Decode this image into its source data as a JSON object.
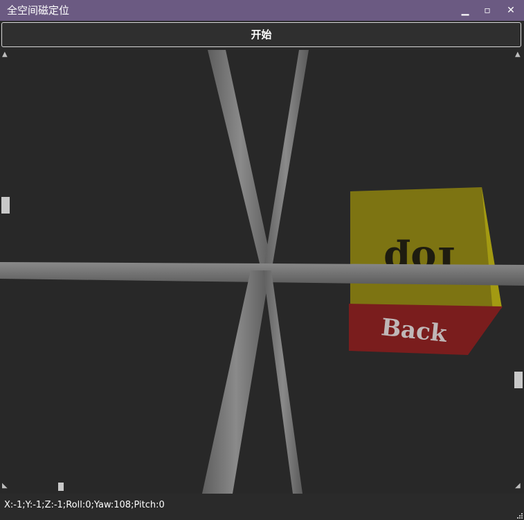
{
  "window": {
    "title": "全空间磁定位",
    "minimize_glyph": "▁",
    "maximize_glyph": "▫",
    "close_glyph": "✕"
  },
  "toolbar": {
    "start_label": "开始"
  },
  "scene": {
    "cube_top_label": "Top",
    "cube_back_label": "Back",
    "colors": {
      "axis_rod": "#7a7a7a",
      "cube_top": "#7d7412",
      "cube_back": "#7a1d1d",
      "cube_side": "#a39a12"
    }
  },
  "status": {
    "text": "X:-1;Y:-1;Z:-1;Roll:0;Yaw:108;Pitch:0"
  }
}
